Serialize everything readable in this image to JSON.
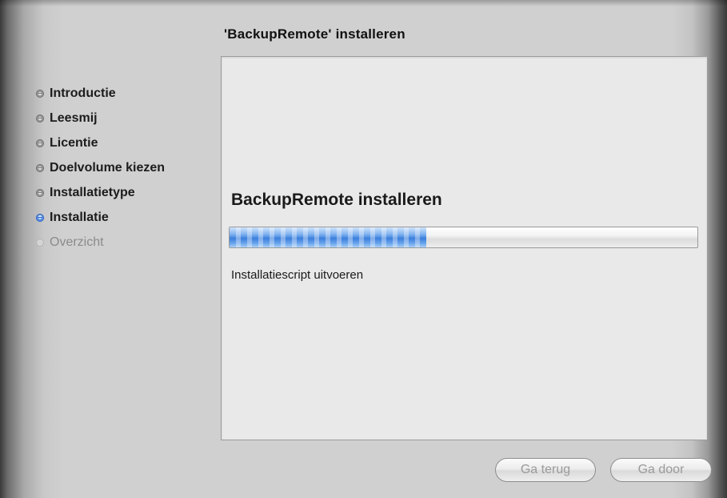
{
  "window": {
    "title": "'BackupRemote' installeren"
  },
  "sidebar": {
    "steps": [
      {
        "label": "Introductie",
        "state": "done"
      },
      {
        "label": "Leesmij",
        "state": "done"
      },
      {
        "label": "Licentie",
        "state": "done"
      },
      {
        "label": "Doelvolume kiezen",
        "state": "done"
      },
      {
        "label": "Installatietype",
        "state": "done"
      },
      {
        "label": "Installatie",
        "state": "active"
      },
      {
        "label": "Overzicht",
        "state": "pending"
      }
    ]
  },
  "main": {
    "heading": "BackupRemote installeren",
    "progress_fraction": 0.42,
    "status": "Installatiescript uitvoeren"
  },
  "buttons": {
    "back_label": "Ga terug",
    "continue_label": "Ga door"
  },
  "colors": {
    "active_step": "#2c5fbf",
    "progress_blue": "#3c7fdd",
    "disabled_text": "#9a9a9a"
  }
}
